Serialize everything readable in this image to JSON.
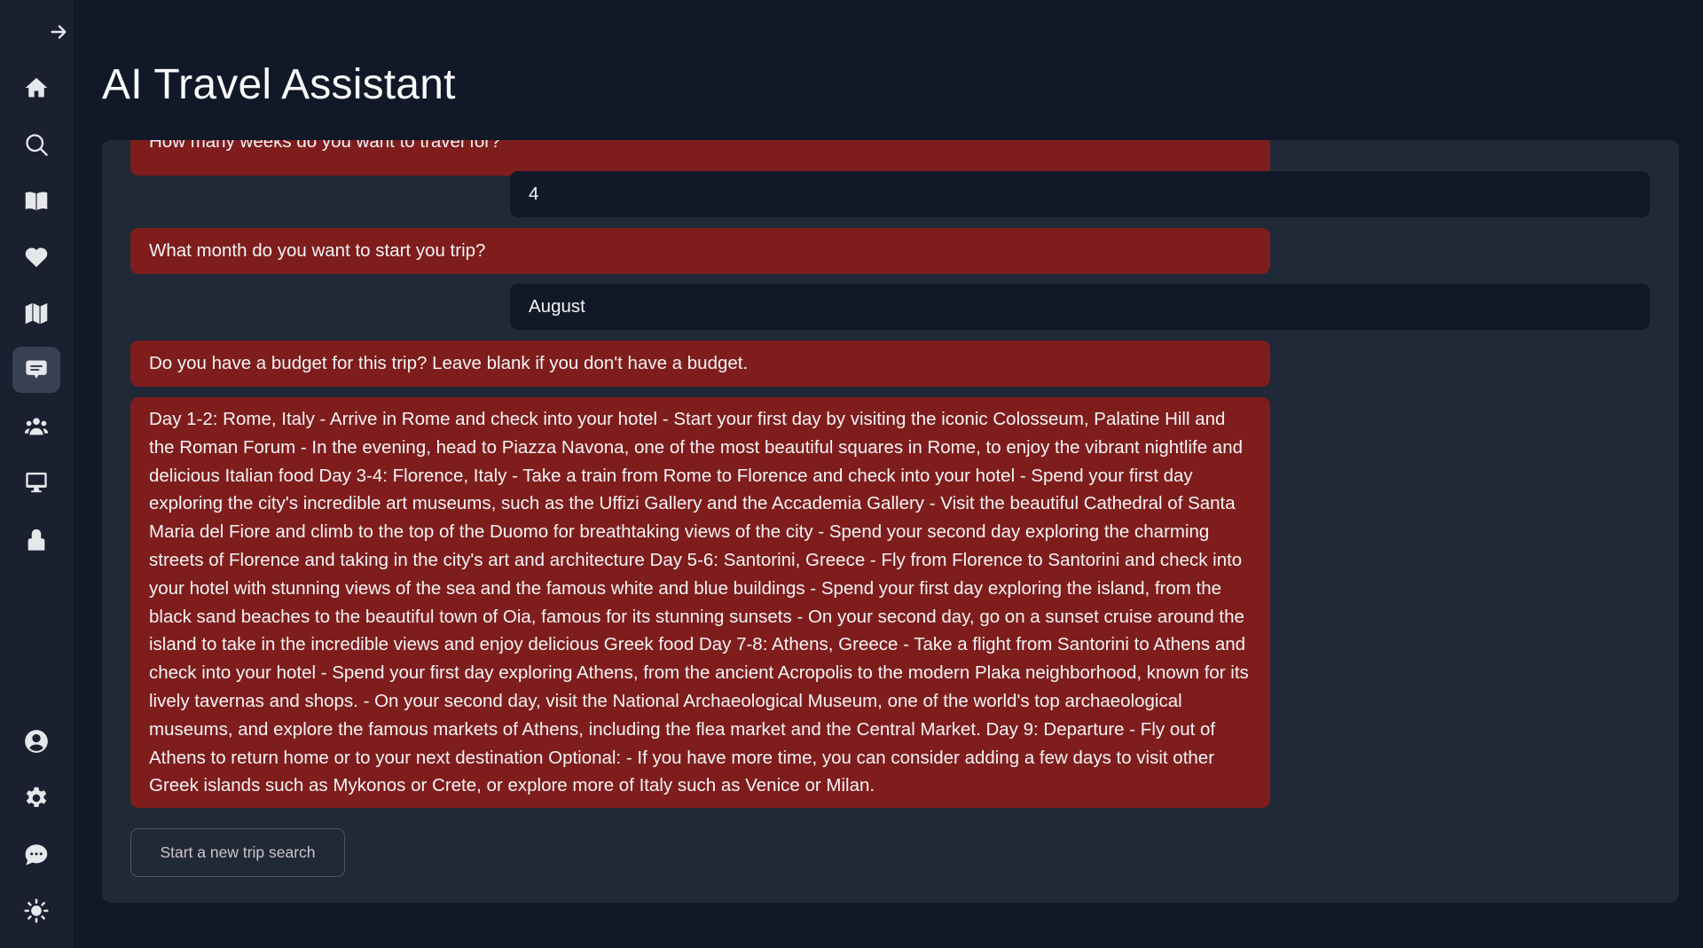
{
  "app": {
    "title": "AI Travel Assistant"
  },
  "sidebar": {
    "toggle_icon": "arrow-right-icon",
    "top_items": [
      {
        "name": "home",
        "icon": "home-icon",
        "active": false
      },
      {
        "name": "search",
        "icon": "search-icon",
        "active": false
      },
      {
        "name": "guides",
        "icon": "book-open-icon",
        "active": false
      },
      {
        "name": "favorites",
        "icon": "heart-icon",
        "active": false
      },
      {
        "name": "map",
        "icon": "map-icon",
        "active": false
      },
      {
        "name": "chat",
        "icon": "chat-bubble-icon",
        "active": true
      },
      {
        "name": "community",
        "icon": "users-icon",
        "active": false
      },
      {
        "name": "desktop",
        "icon": "monitor-icon",
        "active": false
      },
      {
        "name": "user",
        "icon": "user-icon",
        "active": false
      }
    ],
    "bottom_items": [
      {
        "name": "account",
        "icon": "user-circle-icon"
      },
      {
        "name": "settings",
        "icon": "gear-icon"
      },
      {
        "name": "feedback",
        "icon": "chat-dots-icon"
      },
      {
        "name": "theme",
        "icon": "sun-icon"
      }
    ]
  },
  "chat": {
    "messages": [
      {
        "role": "assistant",
        "text": "How many weeks do you want to travel for?"
      },
      {
        "role": "user",
        "text": "4"
      },
      {
        "role": "assistant",
        "text": "What month do you want to start you trip?"
      },
      {
        "role": "user",
        "text": "August"
      },
      {
        "role": "assistant",
        "text": "Do you have a budget for this trip? Leave blank if you don't have a budget."
      },
      {
        "role": "assistant",
        "text": "Day 1-2: Rome, Italy - Arrive in Rome and check into your hotel - Start your first day by visiting the iconic Colosseum, Palatine Hill and the Roman Forum - In the evening, head to Piazza Navona, one of the most beautiful squares in Rome, to enjoy the vibrant nightlife and delicious Italian food Day 3-4: Florence, Italy - Take a train from Rome to Florence and check into your hotel - Spend your first day exploring the city's incredible art museums, such as the Uffizi Gallery and the Accademia Gallery - Visit the beautiful Cathedral of Santa Maria del Fiore and climb to the top of the Duomo for breathtaking views of the city - Spend your second day exploring the charming streets of Florence and taking in the city's art and architecture Day 5-6: Santorini, Greece - Fly from Florence to Santorini and check into your hotel with stunning views of the sea and the famous white and blue buildings - Spend your first day exploring the island, from the black sand beaches to the beautiful town of Oia, famous for its stunning sunsets - On your second day, go on a sunset cruise around the island to take in the incredible views and enjoy delicious Greek food Day 7-8: Athens, Greece - Take a flight from Santorini to Athens and check into your hotel - Spend your first day exploring Athens, from the ancient Acropolis to the modern Plaka neighborhood, known for its lively tavernas and shops. - On your second day, visit the National Archaeological Museum, one of the world's top archaeological museums, and explore the famous markets of Athens, including the flea market and the Central Market. Day 9: Departure - Fly out of Athens to return home or to your next destination Optional: - If you have more time, you can consider adding a few days to visit other Greek islands such as Mykonos or Crete, or explore more of Italy such as Venice or Milan."
      }
    ]
  },
  "actions": {
    "new_search_label": "Start a new trip search"
  },
  "colors": {
    "assistant_bubble": "#7f1d1d",
    "user_bubble": "#111827",
    "panel": "#1f2937",
    "background": "#111827",
    "sidebar": "#1a2030"
  }
}
